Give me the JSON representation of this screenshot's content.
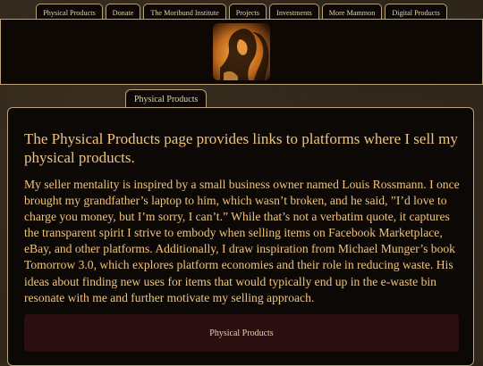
{
  "nav": {
    "items": [
      {
        "label": "Physical Products"
      },
      {
        "label": "Donate"
      },
      {
        "label": "The Moribund Institute"
      },
      {
        "label": "Projects"
      },
      {
        "label": "Investments"
      },
      {
        "label": "More Mammon"
      },
      {
        "label": "Digital Products"
      }
    ]
  },
  "section_tab": {
    "label": "Physical Products"
  },
  "main": {
    "heading": "The Physical Products page provides links to platforms where I sell my physical products.",
    "paragraph": "My seller mentality is inspired by a small business owner named Louis Rossmann. I once brought my grandfather’s laptop to him, which wasn’t broken, and he said, ”I’d love to charge you money, but I’m sorry, I can’t.” While that’s not a verbatim quote, it captures the transparent spirit I strive to embody when selling items on Facebook Marketplace, eBay, and other platforms. Additionally, I draw inspiration from Michael Munger’s book Tomorrow 3.0, which explores platform economies and their role in reducing waste. His ideas about finding new uses for items that would typically end up in the e-waste bin resonate with me and further motivate my selling approach.",
    "link_button": "Physical Products"
  },
  "colors": {
    "text_gold": "#f1c47a",
    "border": "#b8a27e",
    "panel_bg": "#0c0806",
    "button_bg": "#2a0e10"
  },
  "icons": {
    "logo": "artwork-portrait-logo"
  }
}
